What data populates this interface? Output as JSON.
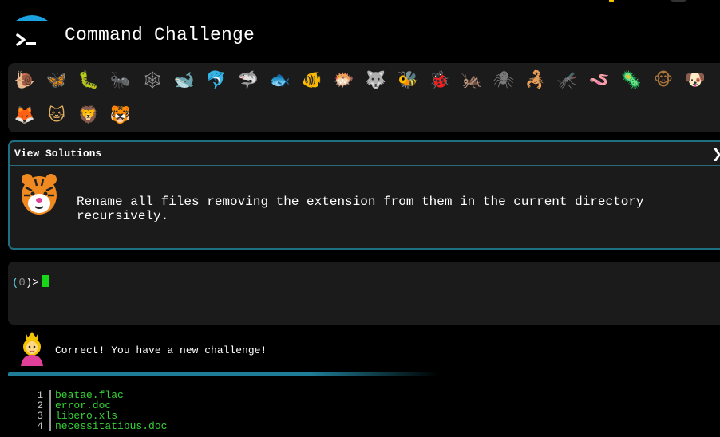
{
  "header": {
    "title": "Command Challenge",
    "logo_icon": "terminal-umbrella-icon"
  },
  "badges": [
    {
      "name": "snail",
      "glyph": "🐌",
      "color": "#c9a46a"
    },
    {
      "name": "butterfly",
      "glyph": "🦋",
      "color": "#e0a030"
    },
    {
      "name": "caterpillar",
      "glyph": "🐛",
      "color": "#6fd14a"
    },
    {
      "name": "ant",
      "glyph": "🐜",
      "color": "#7a5a2a"
    },
    {
      "name": "spider-web",
      "glyph": "🕸",
      "color": "#9a9a9a"
    },
    {
      "name": "whale",
      "glyph": "🐋",
      "color": "#3a9ad9"
    },
    {
      "name": "dolphin",
      "glyph": "🐬",
      "color": "#3a8fd0"
    },
    {
      "name": "shark",
      "glyph": "🦈",
      "color": "#8aa0b4"
    },
    {
      "name": "fish",
      "glyph": "🐟",
      "color": "#3a9ad9"
    },
    {
      "name": "tropical-fish",
      "glyph": "🐠",
      "color": "#f0c020"
    },
    {
      "name": "blowfish",
      "glyph": "🐡",
      "color": "#c9a46a"
    },
    {
      "name": "wolf",
      "glyph": "🐺",
      "color": "#a0a0a0"
    },
    {
      "name": "bee",
      "glyph": "🐝",
      "color": "#e8c02a"
    },
    {
      "name": "ladybug",
      "glyph": "🐞",
      "color": "#e03030"
    },
    {
      "name": "cricket",
      "glyph": "🦗",
      "color": "#5cc23a"
    },
    {
      "name": "spider",
      "glyph": "🕷",
      "color": "#7a7a7a"
    },
    {
      "name": "scorpion",
      "glyph": "🦂",
      "color": "#d0462a"
    },
    {
      "name": "mosquito",
      "glyph": "🦟",
      "color": "#b0b0b0"
    },
    {
      "name": "worm",
      "glyph": "🪱",
      "color": "#e080b0"
    },
    {
      "name": "microbe",
      "glyph": "🦠",
      "color": "#5ab0e0"
    },
    {
      "name": "monkey",
      "glyph": "🐵",
      "color": "#a8743a"
    },
    {
      "name": "dog",
      "glyph": "🐶",
      "color": "#d9a04a"
    },
    {
      "name": "fox",
      "glyph": "🦊",
      "color": "#e07a2a"
    },
    {
      "name": "cat",
      "glyph": "🐱",
      "color": "#e0b060"
    },
    {
      "name": "lion",
      "glyph": "🦁",
      "color": "#e0a040"
    },
    {
      "name": "tiger",
      "glyph": "🐯",
      "color": "#f08a20"
    }
  ],
  "solutions": {
    "title": "View Solutions",
    "chevron": "❯",
    "avatar_icon": "tiger-icon",
    "challenge_text": "Rename all files removing the extension from them in the current directory recursively."
  },
  "terminal": {
    "open_paren": "(",
    "exit_code": "0",
    "close_prompt": ")>"
  },
  "message": {
    "avatar_icon": "princess-icon",
    "text": "Correct! You have a new challenge!"
  },
  "progress": 0.6,
  "files": [
    {
      "line": "1",
      "name": "beatae.flac"
    },
    {
      "line": "2",
      "name": "error.doc"
    },
    {
      "line": "3",
      "name": "libero.xls"
    },
    {
      "line": "4",
      "name": "necessitatibus.doc"
    }
  ],
  "colors": {
    "accent": "#1e7e97",
    "file_green": "#35d235",
    "cursor_green": "#18d618",
    "panel_bg": "#1b1b1b"
  }
}
